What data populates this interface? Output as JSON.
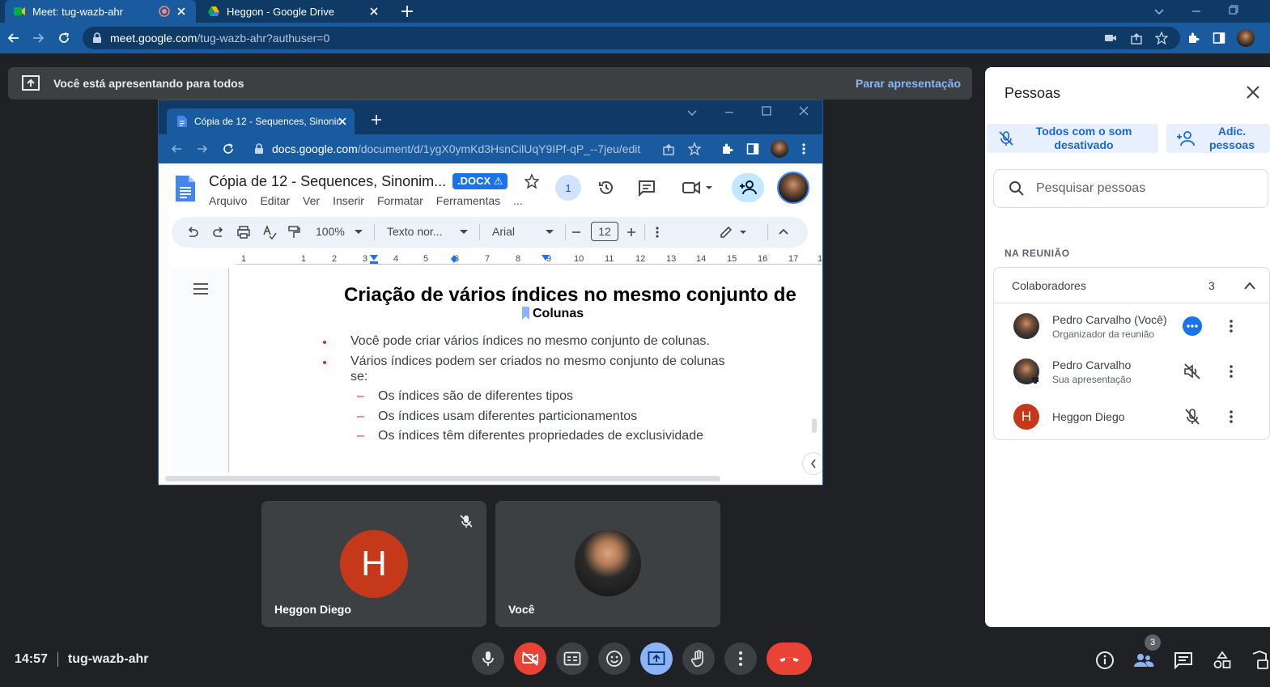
{
  "browser": {
    "tabs": [
      {
        "title": "Meet: tug-wazb-ahr"
      },
      {
        "title": "Heggon - Google Drive"
      }
    ],
    "url_host": "meet.google.com",
    "url_path": "/tug-wazb-ahr?authuser=0"
  },
  "banner": {
    "text": "Você está apresentando para todos",
    "stop_label": "Parar apresentação"
  },
  "docs_window": {
    "tab_title": "Cópia de 12 - Sequences, Sinonim",
    "url_host": "docs.google.com",
    "url_path": "/document/d/1ygX0ymKd3HsnCilUqY9IPf-qP_--7jeu/edit",
    "doc_title": "Cópia de 12 - Sequences, Sinonim...",
    "badge": ".DOCX ⚠",
    "share_count": "1",
    "menu": [
      "Arquivo",
      "Editar",
      "Ver",
      "Inserir",
      "Formatar",
      "Ferramentas",
      "..."
    ],
    "toolbar": {
      "zoom": "100%",
      "style": "Texto nor...",
      "font": "Arial",
      "font_size": "12"
    },
    "ruler": [
      "1",
      "1",
      "2",
      "3",
      "4",
      "5",
      "6",
      "7",
      "8",
      "9",
      "10",
      "11",
      "12",
      "13",
      "14",
      "15",
      "16",
      "17",
      "1"
    ],
    "content": {
      "heading": "Criação de vários índices no mesmo conjunto de",
      "subheading": "Colunas",
      "bullets": [
        "Você pode criar vários índices no mesmo conjunto de colunas.",
        "Vários índices podem ser criados no mesmo conjunto de colunas",
        "se:"
      ],
      "sub_bullets": [
        "Os índices são de diferentes tipos",
        "Os índices usam diferentes particionamentos",
        "Os índices têm diferentes propriedades de exclusividade"
      ]
    }
  },
  "tiles": [
    {
      "name": "Heggon Diego",
      "initial": "H"
    },
    {
      "name": "Você"
    }
  ],
  "people_panel": {
    "title": "Pessoas",
    "mute_all_label": "Todos com o som desativado",
    "add_people_label": "Adic. pessoas",
    "search_placeholder": "Pesquisar pessoas",
    "section_label": "NA REUNIÃO",
    "group_label": "Colaboradores",
    "group_count": "3",
    "people": [
      {
        "name": "Pedro Carvalho (Você)",
        "role": "Organizador da reunião"
      },
      {
        "name": "Pedro Carvalho",
        "role": "Sua apresentação"
      },
      {
        "name": "Heggon Diego",
        "initial": "H"
      }
    ]
  },
  "bottom_bar": {
    "time": "14:57",
    "meeting_code": "tug-wazb-ahr",
    "people_badge": "3"
  },
  "colors": {
    "accent_blue": "#1a73e8",
    "red": "#ea4335",
    "avatar_h": "#c5391a"
  }
}
